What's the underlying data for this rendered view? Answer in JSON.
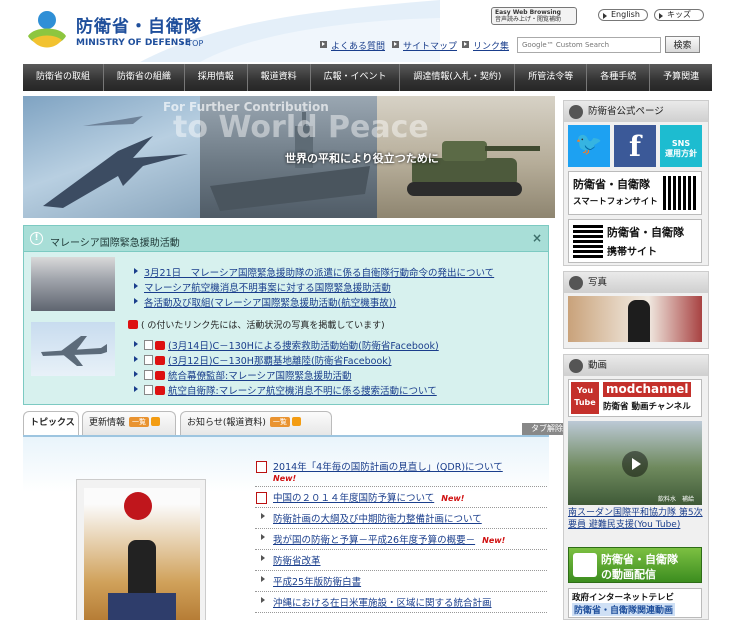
{
  "header": {
    "logo_ja": "防衛省・自衛隊",
    "logo_en": "MINISTRY OF DEFENSE",
    "logo_top": "• TOP",
    "easyweb_title": "Easy Web Browsing",
    "easyweb_sub": "音声読み上げ・閲覧補助",
    "english": "English",
    "kids": "キッズ",
    "faq": "よくある質問",
    "sitemap": "サイトマップ",
    "links": "リンク集",
    "search_placeholder": "Google™ Custom Search",
    "search_button": "検索"
  },
  "gnav": [
    "防衛省の取組",
    "防衛省の組織",
    "採用情報",
    "報道資料",
    "広報・イベント",
    "調達情報(入札・契約)",
    "所管法令等",
    "各種手続",
    "予算関連"
  ],
  "hero": {
    "english_line1": "For Further Contribution",
    "english_line2": "to World Peace",
    "japanese": "世界の平和により役立つために"
  },
  "notice": {
    "title": "マレーシア国際緊急援助活動",
    "close": "×",
    "items": [
      "3月21日　マレーシア国際緊急援助隊の派遣に係る自衛隊行動命令の発出について",
      "マレーシア航空機消息不明事案に対する国際緊急援助活動",
      "各活動及び取組(マレーシア国際緊急援助活動(航空機事故))"
    ],
    "note": "( の付いたリンク先には、活動状況の写真を掲載しています)",
    "photo_items": [
      "(3月14日)C－130Hによる捜索救助活動始動(防衛省Facebook)",
      "(3月12日)C－130H那覇基地離陸(防衛省Facebook)",
      "統合幕僚監部:マレーシア国際緊急援助活動",
      "航空自衛隊:マレーシア航空機消息不明に係る捜索活動について"
    ]
  },
  "tabs": {
    "topics": "トピックス",
    "updates": "更新情報",
    "news": "お知らせ(報道資料)",
    "list": "一覧",
    "release": "タブ解除"
  },
  "topics": {
    "items": [
      {
        "text": "2014年「4年毎の国防計画の見直し」(QDR)について",
        "pdf": true,
        "new": true
      },
      {
        "text": "中国の２０１４年度国防予算について",
        "pdf": true,
        "new": true
      },
      {
        "text": "防衛計画の大綱及び中期防衛力整備計画について",
        "pdf": false,
        "new": false
      },
      {
        "text": "我が国の防衛と予算－平成26年度予算の概要－",
        "pdf": false,
        "new": true
      },
      {
        "text": "防衛省改革",
        "pdf": false,
        "new": false
      },
      {
        "text": "平成25年版防衛白書",
        "pdf": false,
        "new": false
      },
      {
        "text": "沖縄における在日米軍施設・区域に関する統合計画",
        "pdf": false,
        "new": false
      }
    ],
    "new_label": "New!"
  },
  "sidebar": {
    "official_title": "防衛省公式ページ",
    "sns_policy": "SNS\n運用方針",
    "smart_line1": "防衛省・自衛隊",
    "smart_line2": "スマートフォンサイト",
    "mobile_line1": "防衛省・自衛隊",
    "mobile_line2": "携帯サイト",
    "photo_title": "写真",
    "video_title": "動画",
    "yt_logo": "You Tube",
    "yt_mod": "modchannel",
    "yt_channel": "防衛省 動画チャンネル",
    "video_caption": "飲料水　補給",
    "video_link": "南スーダン国際平和協力隊 第5次要員 避難民支援(You Tube)",
    "jsdf_video_line1": "防衛省・自衛隊",
    "jsdf_video_line2": "の動画配信",
    "internet_tv_line1": "政府インターネットテレビ",
    "internet_tv_line2": "防衛省・自衛隊関連動画"
  },
  "colors": {
    "brand_blue": "#1f4f9c",
    "nav_bg": "#333333",
    "notice_bg": "#d7f1ee",
    "new_red": "#d01010"
  }
}
